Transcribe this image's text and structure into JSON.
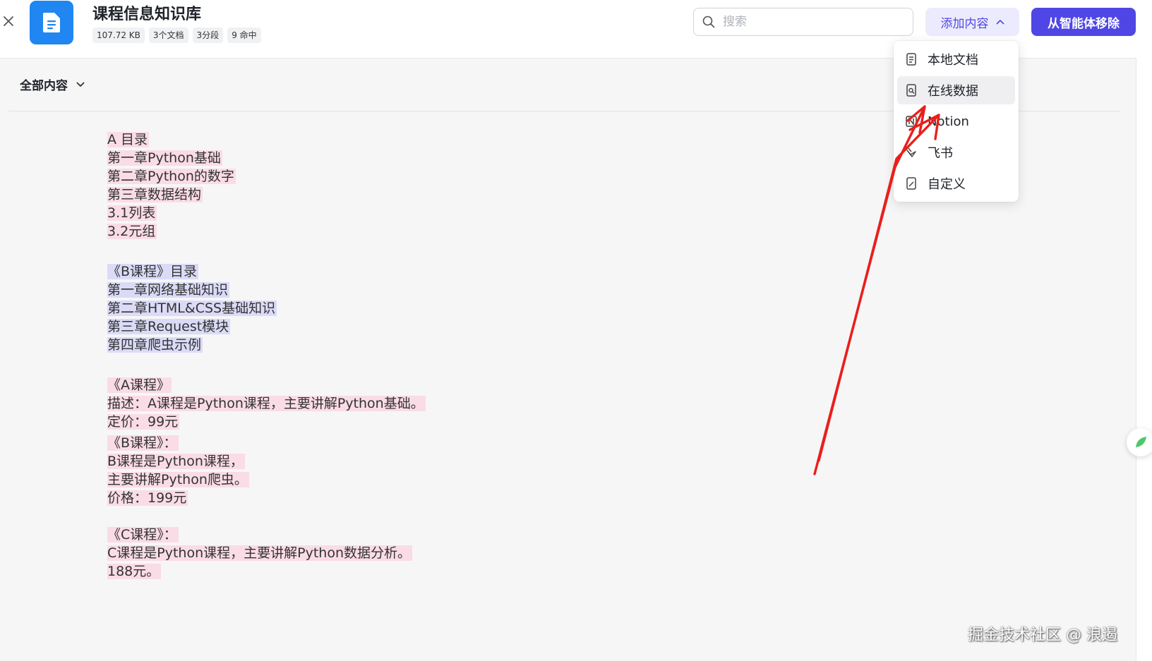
{
  "header": {
    "close_icon": "close-icon",
    "title": "课程信息知识库",
    "tags": [
      "107.72 KB",
      "3个文档",
      "3分段",
      "9 命中"
    ],
    "search_placeholder": "搜索",
    "add_content_label": "添加内容",
    "remove_label": "从智能体移除",
    "accent_color": "#4f46e5"
  },
  "filter": {
    "label": "全部内容"
  },
  "add_menu": {
    "items": [
      {
        "label": "本地文档",
        "icon": "local-document-icon"
      },
      {
        "label": "在线数据",
        "icon": "online-data-icon",
        "hovered": true
      },
      {
        "label": "Notion",
        "icon": "notion-icon"
      },
      {
        "label": "飞书",
        "icon": "feishu-icon"
      },
      {
        "label": "自定义",
        "icon": "custom-icon"
      }
    ]
  },
  "segments": [
    {
      "color": "pink",
      "lines": [
        "A 目录",
        "第一章Python基础",
        "第二章Python的数字",
        "第三章数据结构",
        "3.1列表",
        "3.2元组"
      ]
    },
    {
      "color": "lavender",
      "lines": [
        "《B课程》目录",
        "第一章网络基础知识",
        "第二章HTML&CSS基础知识",
        "第三章Request模块",
        "第四章爬虫示例"
      ]
    },
    {
      "color": "pink",
      "lines": [
        "《A课程》",
        "描述：A课程是Python课程，主要讲解Python基础。",
        "定价：99元"
      ]
    },
    {
      "color": "pink",
      "lines": [
        "《B课程》：",
        "B课程是Python课程，",
        "主要讲解Python爬虫。",
        "价格：199元"
      ]
    },
    {
      "color": "pink",
      "lines": [
        "《C课程》：",
        "C课程是Python课程，主要讲解Python数据分析。",
        "188元。"
      ]
    }
  ],
  "watermark": "掘金技术社区 @ 浪遏"
}
